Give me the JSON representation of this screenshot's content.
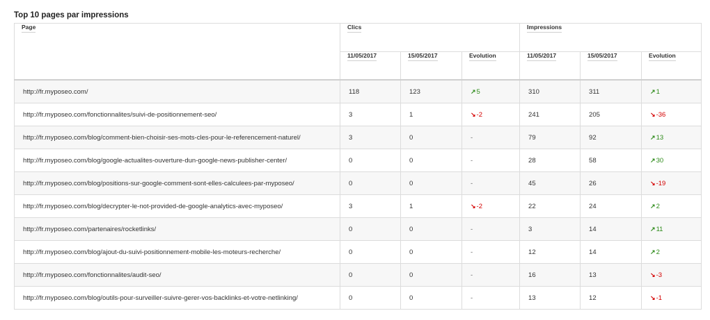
{
  "title": "Top 10 pages par impressions",
  "colors": {
    "up": "#2e8b1a",
    "down": "#d40000"
  },
  "headers": {
    "page": "Page",
    "clics": "Clics",
    "impressions": "Impressions",
    "date1": "11/05/2017",
    "date2": "15/05/2017",
    "evolution": "Evolution"
  },
  "rows": [
    {
      "page": "http://fr.myposeo.com/",
      "c1": "118",
      "c2": "123",
      "cev": "5",
      "cdir": "up",
      "i1": "310",
      "i2": "311",
      "iev": "1",
      "idir": "up"
    },
    {
      "page": "http://fr.myposeo.com/fonctionnalites/suivi-de-positionnement-seo/",
      "c1": "3",
      "c2": "1",
      "cev": "-2",
      "cdir": "down",
      "i1": "241",
      "i2": "205",
      "iev": "-36",
      "idir": "down"
    },
    {
      "page": "http://fr.myposeo.com/blog/comment-bien-choisir-ses-mots-cles-pour-le-referencement-naturel/",
      "c1": "3",
      "c2": "0",
      "cev": "-",
      "cdir": "none",
      "i1": "79",
      "i2": "92",
      "iev": "13",
      "idir": "up"
    },
    {
      "page": "http://fr.myposeo.com/blog/google-actualites-ouverture-dun-google-news-publisher-center/",
      "c1": "0",
      "c2": "0",
      "cev": "-",
      "cdir": "none",
      "i1": "28",
      "i2": "58",
      "iev": "30",
      "idir": "up"
    },
    {
      "page": "http://fr.myposeo.com/blog/positions-sur-google-comment-sont-elles-calculees-par-myposeo/",
      "c1": "0",
      "c2": "0",
      "cev": "-",
      "cdir": "none",
      "i1": "45",
      "i2": "26",
      "iev": "-19",
      "idir": "down"
    },
    {
      "page": "http://fr.myposeo.com/blog/decrypter-le-not-provided-de-google-analytics-avec-myposeo/",
      "c1": "3",
      "c2": "1",
      "cev": "-2",
      "cdir": "down",
      "i1": "22",
      "i2": "24",
      "iev": "2",
      "idir": "up"
    },
    {
      "page": "http://fr.myposeo.com/partenaires/rocketlinks/",
      "c1": "0",
      "c2": "0",
      "cev": "-",
      "cdir": "none",
      "i1": "3",
      "i2": "14",
      "iev": "11",
      "idir": "up"
    },
    {
      "page": "http://fr.myposeo.com/blog/ajout-du-suivi-positionnement-mobile-les-moteurs-recherche/",
      "c1": "0",
      "c2": "0",
      "cev": "-",
      "cdir": "none",
      "i1": "12",
      "i2": "14",
      "iev": "2",
      "idir": "up"
    },
    {
      "page": "http://fr.myposeo.com/fonctionnalites/audit-seo/",
      "c1": "0",
      "c2": "0",
      "cev": "-",
      "cdir": "none",
      "i1": "16",
      "i2": "13",
      "iev": "-3",
      "idir": "down"
    },
    {
      "page": "http://fr.myposeo.com/blog/outils-pour-surveiller-suivre-gerer-vos-backlinks-et-votre-netlinking/",
      "c1": "0",
      "c2": "0",
      "cev": "-",
      "cdir": "none",
      "i1": "13",
      "i2": "12",
      "iev": "-1",
      "idir": "down"
    }
  ]
}
